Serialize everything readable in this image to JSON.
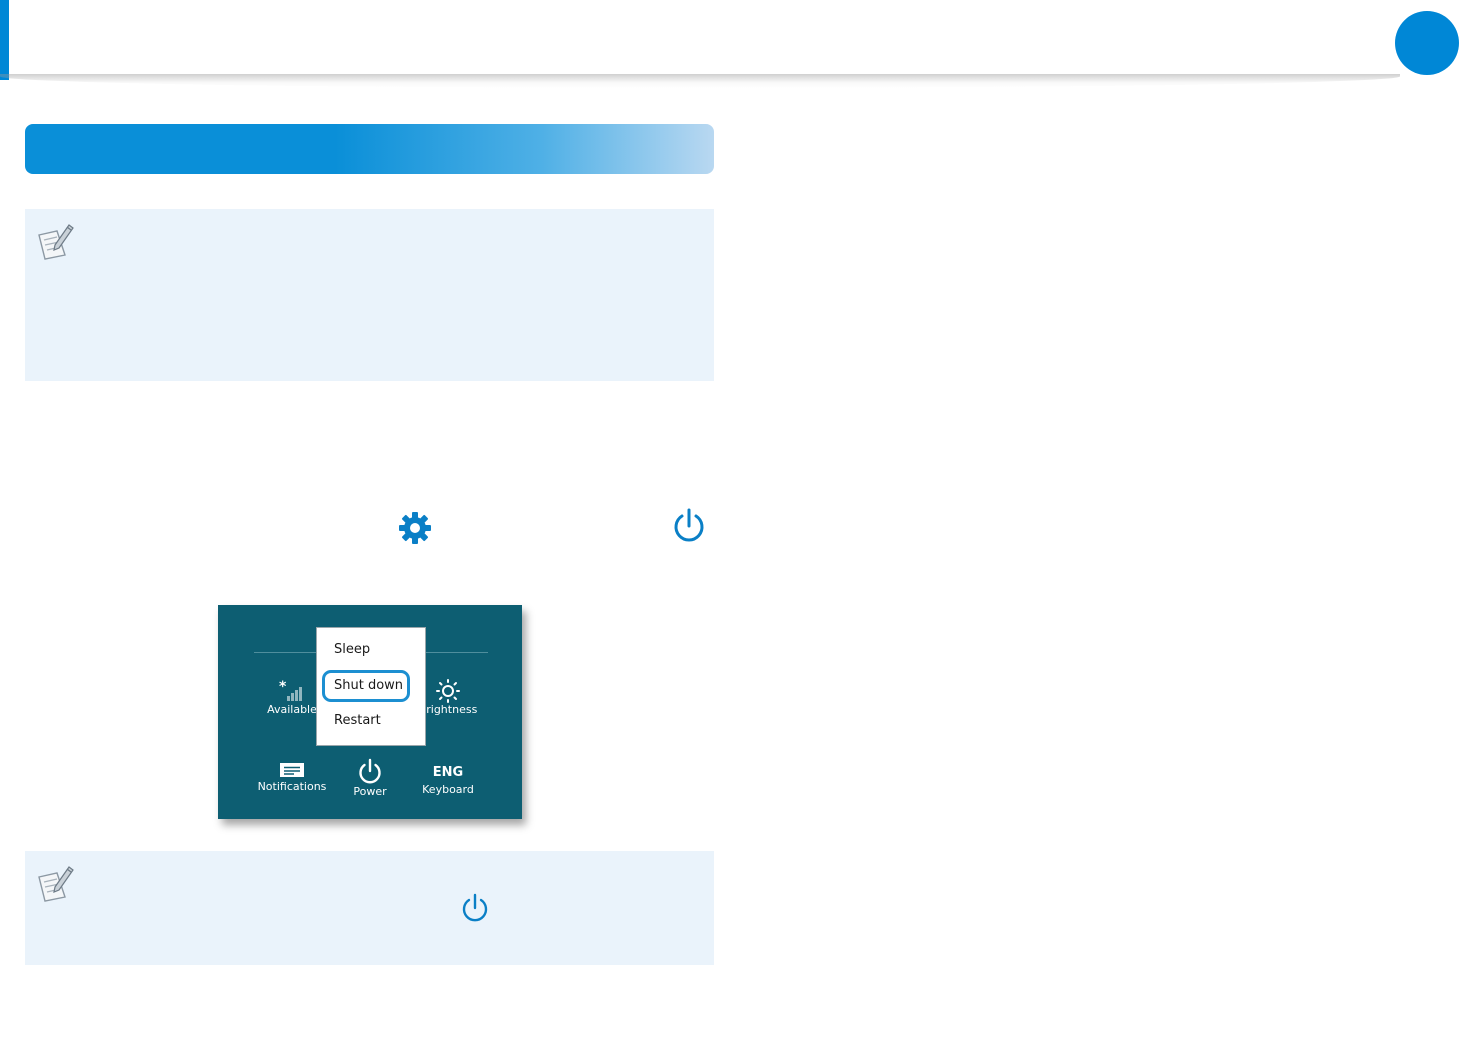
{
  "colors": {
    "accent": "#0087d6",
    "note_background": "#eaf3fb",
    "screenshot_background": "#0d5e72",
    "highlight": "#1c8fd1"
  },
  "icons": {
    "inline_settings": "gear-icon",
    "inline_power": "power-icon",
    "note": "note-pencil-icon"
  },
  "screenshot": {
    "menu": {
      "items": [
        "Sleep",
        "Shut down",
        "Restart"
      ],
      "highlighted": "Shut down"
    },
    "tiles": {
      "network": "Available",
      "brightness": "Brightness",
      "notifications": "Notifications",
      "power": "Power",
      "keyboard_label": "Keyboard",
      "keyboard_value": "ENG"
    }
  }
}
